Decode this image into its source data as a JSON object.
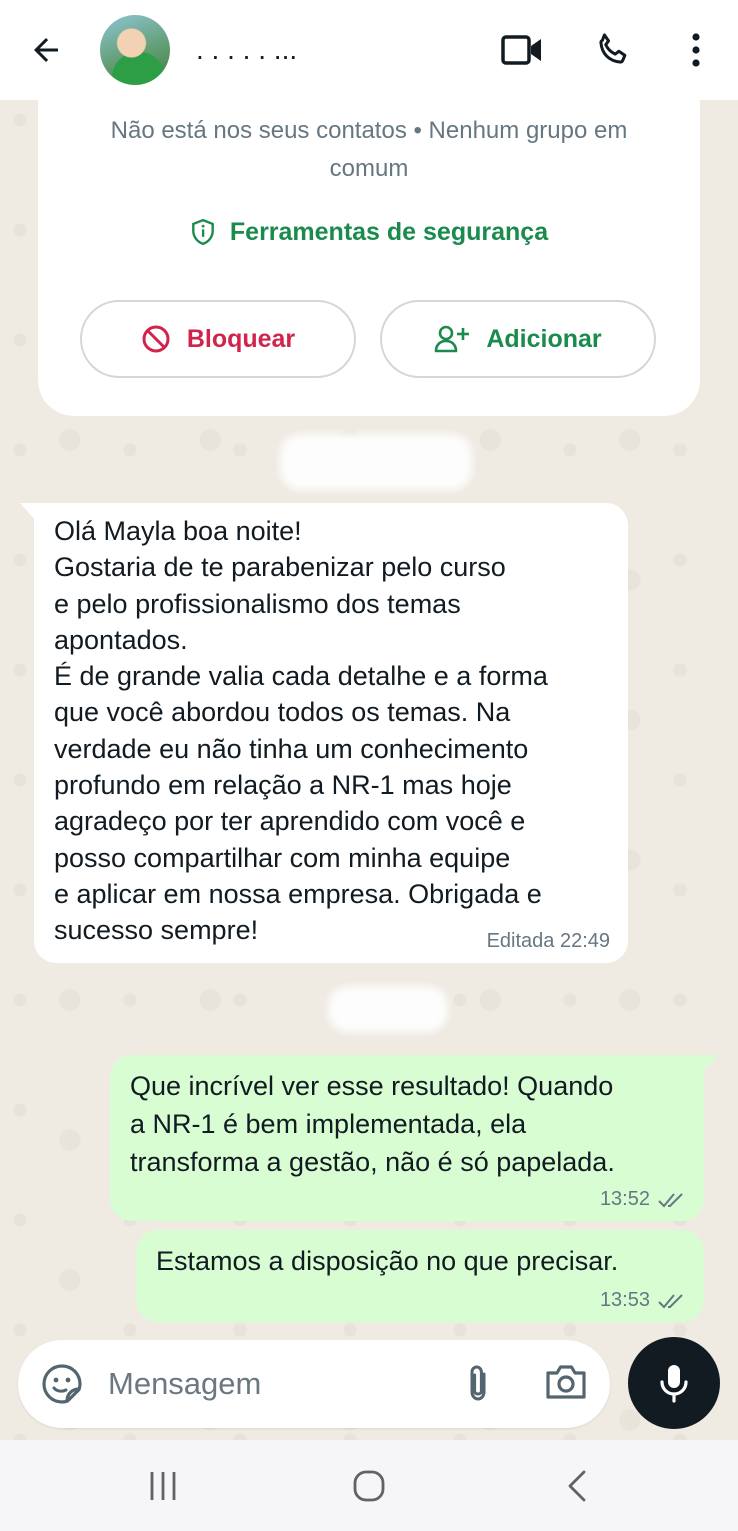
{
  "header": {
    "contact_name": ". . . . . ...",
    "icons": [
      "back-arrow-icon",
      "video-call-icon",
      "phone-icon",
      "more-vert-icon"
    ]
  },
  "info_card": {
    "notice": "Não está nos seus contatos • Nenhum grupo em comum",
    "security_tools": "Ferramentas de segurança",
    "block_label": "Bloquear",
    "add_label": "Adicionar"
  },
  "messages": [
    {
      "direction": "incoming",
      "text": "Olá Mayla boa noite!\nGostaria de te parabenizar pelo curso\ne pelo profissionalismo dos temas\napontados.\nÉ de grande valia cada detalhe e a forma\nque você abordou todos os temas. Na\nverdade eu não tinha um conhecimento\nprofundo em relação a NR-1 mas hoje\nagradeço por ter aprendido com você e\nposso compartilhar com minha equipe\ne aplicar em nossa empresa. Obrigada e\nsucesso sempre!",
      "meta": "Editada 22:49"
    },
    {
      "direction": "outgoing",
      "text": "Que incrível ver esse resultado! Quando\na NR-1 é bem implementada, ela\ntransforma a gestão, não é só papelada.",
      "time": "13:52",
      "status": "read"
    },
    {
      "direction": "outgoing",
      "text": "Estamos a disposição no que precisar.",
      "time": "13:53",
      "status": "read"
    }
  ],
  "composer": {
    "placeholder": "Mensagem"
  },
  "colors": {
    "accent_green": "#1a8b4c",
    "block_red": "#d1244c",
    "outgoing_bubble": "#d9fdd3",
    "chat_background": "#efeae2"
  }
}
